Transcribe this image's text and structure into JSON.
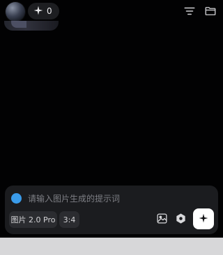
{
  "header": {
    "credits_count": "0",
    "avatar_icon": "avatar",
    "credits_icon": "sparkle-icon",
    "filter_icon": "filter-icon",
    "folder_icon": "folder-icon"
  },
  "composer": {
    "placeholder": "请输入图片生成的提示词",
    "value": "",
    "status_color": "#3a9be9",
    "model_label": "图片 2.0 Pro",
    "ratio_label": "3:4",
    "image_icon": "image-icon",
    "settings_icon": "hexagon-settings-icon",
    "generate_icon": "sparkle-icon"
  },
  "colors": {
    "background": "#020203",
    "panel": "#1b1c1f",
    "chip": "#2b2c30",
    "generate_button": "#ffffff"
  }
}
